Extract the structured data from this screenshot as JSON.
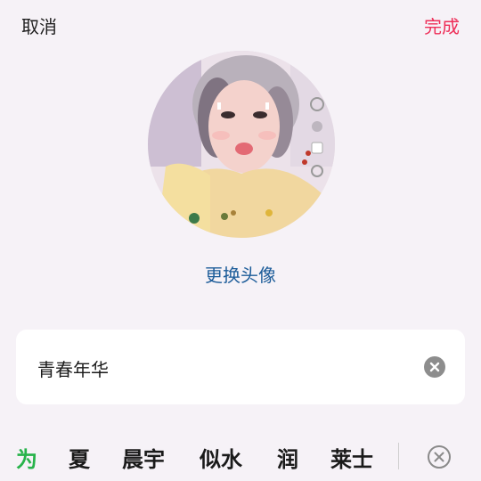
{
  "header": {
    "cancel_label": "取消",
    "done_label": "完成",
    "done_color": "#ee2e58"
  },
  "avatar": {
    "change_label": "更换头像",
    "link_color": "#1c5c99"
  },
  "name_field": {
    "value": "青春年华"
  },
  "ime": {
    "suggestions": [
      "为",
      "夏",
      "晨宇",
      "似水",
      "润",
      "莱士"
    ],
    "highlight_color": "#27b34a"
  }
}
